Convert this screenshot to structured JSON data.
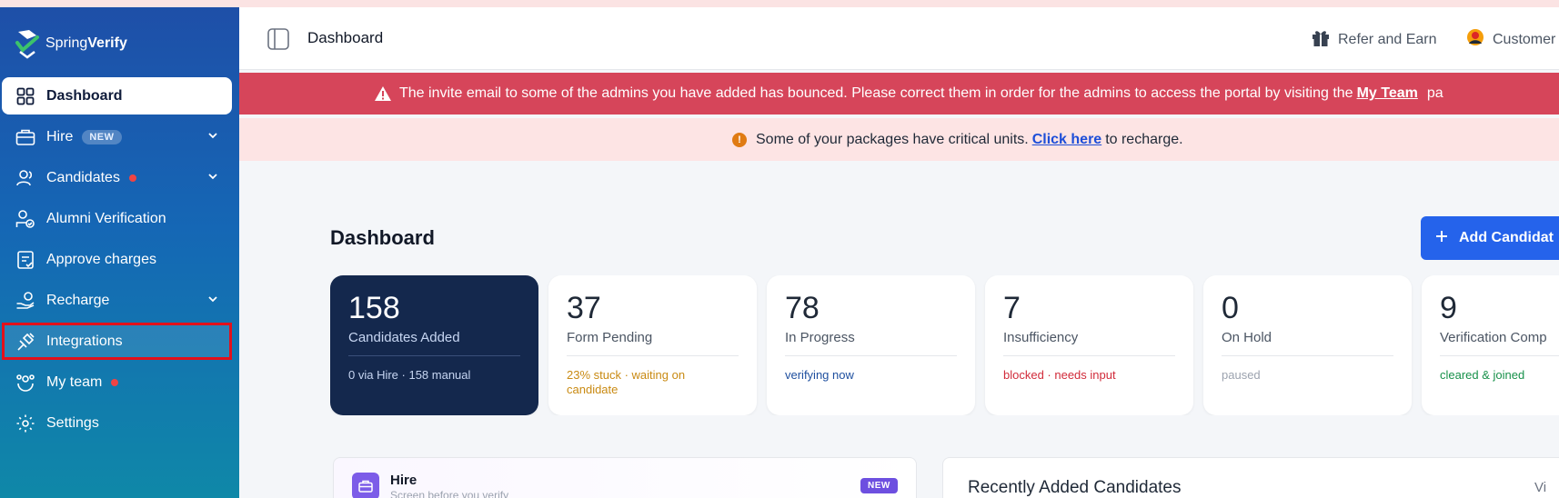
{
  "sidebar": {
    "logo_prefix": "Spring",
    "logo_suffix": "Verify",
    "items": [
      {
        "label": "Dashboard",
        "icon": "grid-icon"
      },
      {
        "label": "Hire",
        "badge": "NEW",
        "icon": "briefcase-icon"
      },
      {
        "label": "Candidates",
        "icon": "users-icon"
      },
      {
        "label": "Alumni Verification",
        "icon": "user-check-icon"
      },
      {
        "label": "Approve charges",
        "icon": "receipt-icon"
      },
      {
        "label": "Recharge",
        "icon": "hand-coin-icon"
      },
      {
        "label": "Integrations",
        "icon": "plug-icon"
      },
      {
        "label": "My team",
        "icon": "team-icon"
      },
      {
        "label": "Settings",
        "icon": "gear-icon"
      }
    ]
  },
  "header": {
    "title": "Dashboard",
    "refer_label": "Refer and Earn",
    "customer_label": "Customer"
  },
  "banners": {
    "bounce_text": "The invite email to some of the admins you have added has bounced. Please correct them in order for the admins to access the portal by visiting the",
    "bounce_link": "My Team",
    "bounce_tail": "pa",
    "packages_text": "Some of your packages have critical units.",
    "packages_link": "Click here",
    "packages_tail": "to recharge."
  },
  "main": {
    "title": "Dashboard",
    "add_button": "Add Candidat",
    "stats": [
      {
        "value": "158",
        "label": "Candidates Added",
        "sub": "0 via Hire · 158 manual",
        "sub_color": "#c7d6f2"
      },
      {
        "value": "37",
        "label": "Form Pending",
        "sub": "23% stuck · waiting on candidate",
        "sub_color": "#c98a12"
      },
      {
        "value": "78",
        "label": "In Progress",
        "sub": "verifying now",
        "sub_color": "#1d4e9e"
      },
      {
        "value": "7",
        "label": "Insufficiency",
        "sub": "blocked · needs input",
        "sub_color": "#d12b3a"
      },
      {
        "value": "0",
        "label": "On Hold",
        "sub": "paused",
        "sub_color": "#9ca3af"
      },
      {
        "value": "9",
        "label": "Verification Comp",
        "sub": "cleared & joined",
        "sub_color": "#17914a"
      }
    ],
    "hire_card": {
      "title": "Hire",
      "subtitle": "Screen before you verify",
      "badge": "NEW"
    },
    "recent_card": {
      "title": "Recently Added Candidates",
      "link": "Vi"
    }
  },
  "colors": {
    "accent": "#2563eb",
    "sidebar_top": "#1e4fa8",
    "sidebar_bottom": "#0f88a8",
    "danger_banner": "#d6455a",
    "warning_banner": "#fde4e4",
    "dark_card": "#14284d"
  }
}
